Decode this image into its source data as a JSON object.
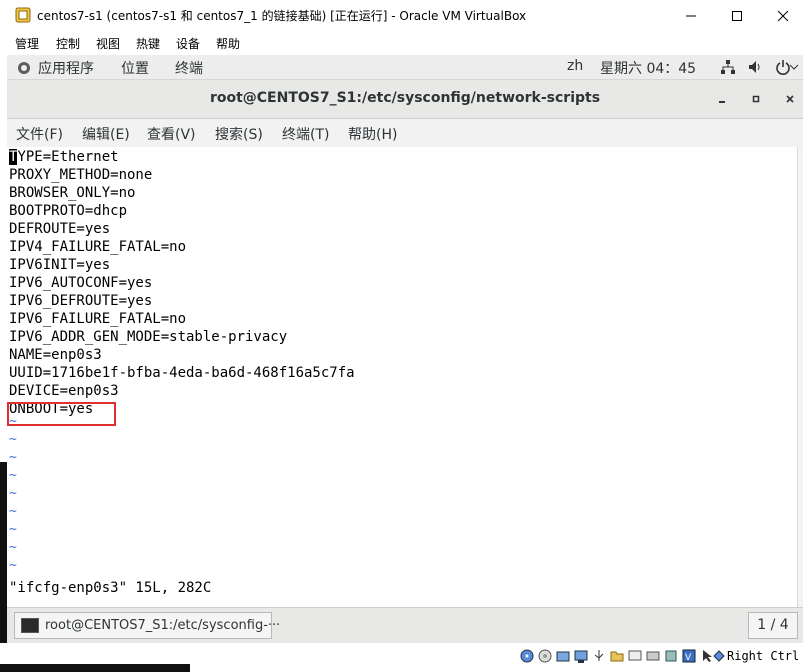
{
  "window": {
    "title": "centos7-s1 (centos7-s1 和 centos7_1 的链接基础) [正在运行] - Oracle VM VirtualBox"
  },
  "vb_menu": [
    "管理",
    "控制",
    "视图",
    "热键",
    "设备",
    "帮助"
  ],
  "gnome_bar": {
    "applications": "应用程序",
    "places": "位置",
    "terminal": "终端",
    "input_method": "zh",
    "clock": "星期六 04：45"
  },
  "terminal": {
    "title": "root@CENTOS7_S1:/etc/sysconfig/network-scripts",
    "menu": [
      "文件(F)",
      "编辑(E)",
      "查看(V)",
      "搜索(S)",
      "终端(T)",
      "帮助(H)"
    ],
    "first_char": "T",
    "first_rest": "YPE=Ethernet",
    "lines": [
      "PROXY_METHOD=none",
      "BROWSER_ONLY=no",
      "BOOTPROTO=dhcp",
      "DEFROUTE=yes",
      "IPV4_FAILURE_FATAL=no",
      "IPV6INIT=yes",
      "IPV6_AUTOCONF=yes",
      "IPV6_DEFROUTE=yes",
      "IPV6_FAILURE_FATAL=no",
      "IPV6_ADDR_GEN_MODE=stable-privacy",
      "NAME=enp0s3",
      "UUID=1716be1f-bfba-4eda-ba6d-468f16a5c7fa",
      "DEVICE=enp0s3",
      "ONBOOT=yes"
    ],
    "tilde": "~",
    "status": "\"ifcfg-enp0s3\" 15L, 282C"
  },
  "taskbar": {
    "task_label": "root@CENTOS7_S1:/etc/sysconfig-···",
    "workspace": "1 / 4"
  },
  "vb_status": {
    "host_key": "Right Ctrl"
  },
  "colors": {
    "highlight_box": "#e03030",
    "tilde": "#4a6fd1"
  }
}
